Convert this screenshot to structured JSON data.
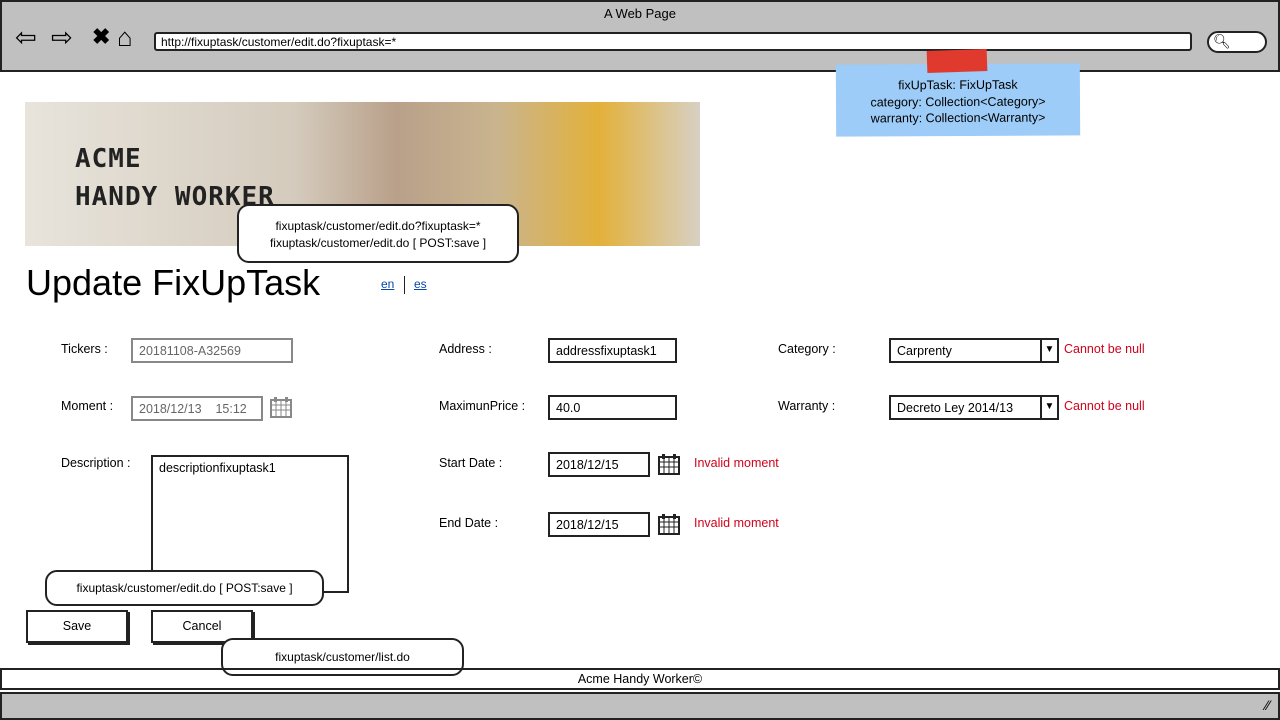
{
  "browser": {
    "title": "A Web Page",
    "url": "http://fixuptask/customer/edit.do?fixuptask=*"
  },
  "note": {
    "lines": [
      "fixUpTask: FixUpTask",
      "category: Collection<Category>",
      "warranty: Collection<Warranty>"
    ]
  },
  "banner": {
    "logo_line1": "ACME",
    "logo_line2": "HANDY WORKER"
  },
  "callouts": {
    "banner_1": "fixuptask/customer/edit.do?fixuptask=*",
    "banner_2": "fixuptask/customer/edit.do [ POST:save ]",
    "save": "fixuptask/customer/edit.do [ POST:save ]",
    "cancel": "fixuptask/customer/list.do"
  },
  "page": {
    "title": "Update FixUpTask",
    "lang_en": "en",
    "lang_es": "es"
  },
  "form": {
    "tickers_label": "Tickers :",
    "tickers_value": "20181108-A32569",
    "moment_label": "Moment :",
    "moment_value": "2018/12/13    15:12",
    "description_label": "Description :",
    "description_value": "descriptionfixuptask1",
    "address_label": "Address :",
    "address_value": "addressfixuptask1",
    "maxprice_label": "MaximunPrice :",
    "maxprice_value": "40.0",
    "start_label": "Start Date :",
    "start_value": "2018/12/15",
    "start_error": "Invalid moment",
    "end_label": "End Date :",
    "end_value": "2018/12/15",
    "end_error": "Invalid moment",
    "category_label": "Category :",
    "category_value": "Carprenty",
    "category_error": "Cannot be null",
    "warranty_label": "Warranty :",
    "warranty_value": "Decreto Ley 2014/13",
    "warranty_error": "Cannot be null"
  },
  "buttons": {
    "save": "Save",
    "cancel": "Cancel"
  },
  "footer": {
    "text": "Acme Handy Worker©"
  }
}
